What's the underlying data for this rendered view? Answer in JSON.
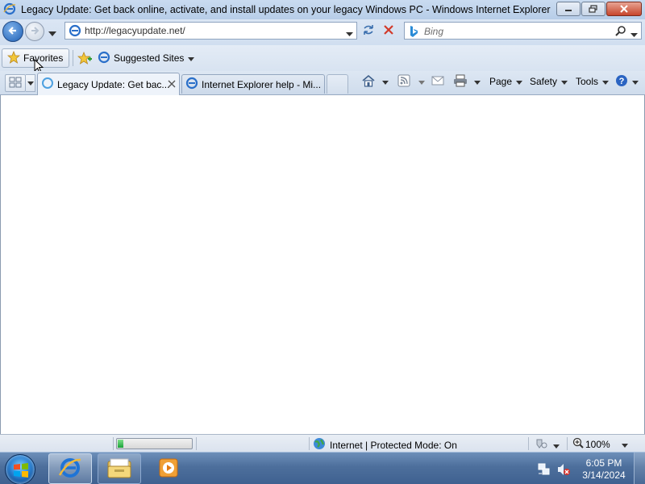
{
  "window": {
    "title": "Legacy Update: Get back online, activate, and install updates on your legacy Windows PC - Windows Internet Explorer"
  },
  "address_bar": {
    "url": "http://legacyupdate.net/"
  },
  "search": {
    "placeholder": "Bing"
  },
  "favorites_bar": {
    "favorites_label": "Favorites",
    "suggested_label": "Suggested Sites"
  },
  "tabs": [
    {
      "label": "Legacy Update: Get bac...",
      "active": true
    },
    {
      "label": "Internet Explorer help - Mi...",
      "active": false
    }
  ],
  "command_bar": {
    "page_label": "Page",
    "safety_label": "Safety",
    "tools_label": "Tools"
  },
  "status_bar": {
    "zone_text": "Internet | Protected Mode: On",
    "zoom_text": "100%",
    "progress_fraction": 0.08
  },
  "taskbar": {
    "time": "6:05 PM",
    "date": "3/14/2024"
  },
  "icons": [
    "ie-icon",
    "back-icon",
    "forward-icon",
    "refresh-icon",
    "stop-icon",
    "bing-icon",
    "search-icon",
    "star-icon",
    "add-favorite-icon",
    "quick-tabs-icon",
    "home-icon",
    "feeds-icon",
    "mail-icon",
    "print-icon",
    "help-icon",
    "globe-icon",
    "windows-orb-icon",
    "folder-icon",
    "media-player-icon",
    "network-icon",
    "volume-muted-icon"
  ],
  "colors": {
    "accent": "#1d5fb5",
    "close_button": "#c7452c",
    "progress": "#1aa23a"
  }
}
